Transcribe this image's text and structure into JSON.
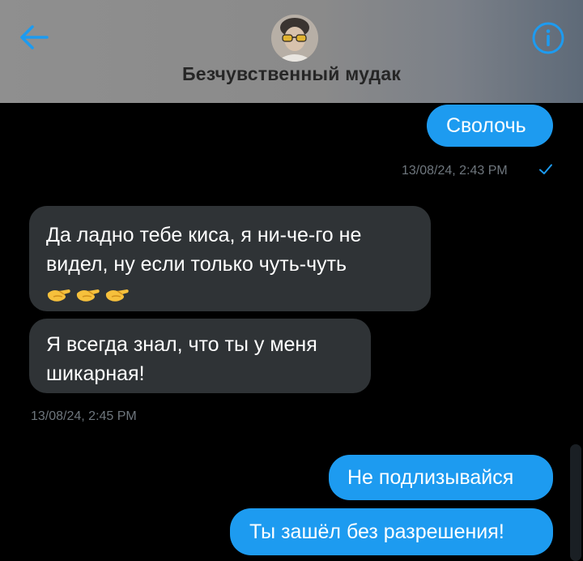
{
  "header": {
    "title": "Безчувственный мудак",
    "back_icon": "arrow-left-icon",
    "info_icon": "info-icon",
    "accent_color": "#1d9bf0"
  },
  "messages": [
    {
      "direction": "outgoing",
      "text": "Сволочь"
    },
    {
      "timestamp": "13/08/24, 2:43 PM",
      "status_icon": "checkmark-icon"
    },
    {
      "direction": "incoming",
      "text": "Да ладно тебе киса, я ни-че-го не видел, ну если только чуть-чуть",
      "emoji": "pinching-hand-emoji x3"
    },
    {
      "direction": "incoming",
      "text": "Я всегда знал, что ты у меня шикарная!"
    },
    {
      "timestamp": "13/08/24, 2:45 PM"
    },
    {
      "direction": "outgoing",
      "text": "Не подлизывайся"
    },
    {
      "direction": "outgoing",
      "text": "Ты зашёл без разрешения!"
    }
  ],
  "colors": {
    "outgoing_bubble": "#1d9bf0",
    "incoming_bubble": "#2f3336",
    "background": "#000000",
    "timestamp": "#6e767d"
  }
}
